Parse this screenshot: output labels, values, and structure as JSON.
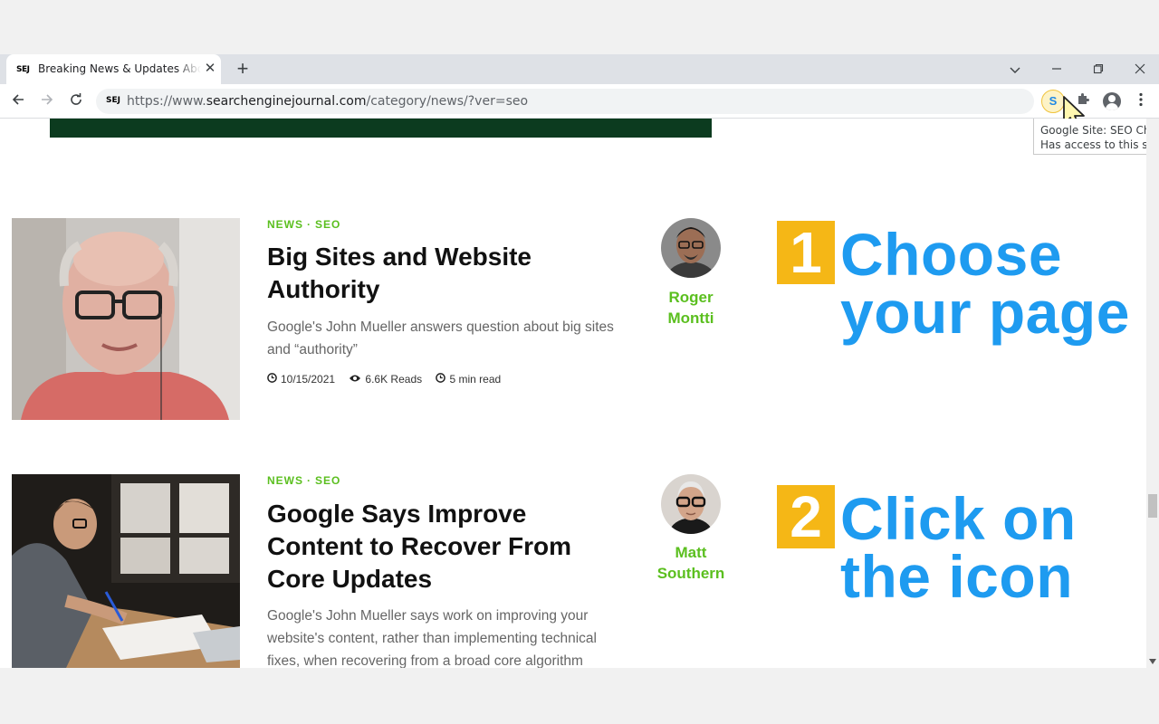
{
  "browser": {
    "tab_title": "Breaking News & Updates About SEO",
    "tab_favicon": "SEJ",
    "close_glyph": "✕",
    "new_tab_glyph": "+",
    "url_prefix": "https://www.",
    "url_host": "searchenginejournal.com",
    "url_path": "/category/news/?ver=seo",
    "omni_favicon": "SEJ",
    "extension_label": "S",
    "tooltip_line1": "Google Site: SEO Check",
    "tooltip_line2": "Has access to this site"
  },
  "articles": [
    {
      "cat1": "NEWS",
      "cat2": "SEO",
      "sep": "·",
      "headline": "Big Sites and Website Authority",
      "excerpt": "Google's John Mueller answers question about big sites and “authority”",
      "date": "10/15/2021",
      "reads": "6.6K Reads",
      "read_time": "5 min read",
      "author": "Roger Montti"
    },
    {
      "cat1": "NEWS",
      "cat2": "SEO",
      "sep": "·",
      "headline": "Google Says Improve Content to Recover From Core Updates",
      "excerpt": "Google's John Mueller says work on improving your website's content, rather than implementing technical fixes, when recovering from a broad core algorithm",
      "author": "Matt Southern"
    }
  ],
  "steps": [
    {
      "number": "1",
      "text": "Choose your page"
    },
    {
      "number": "2",
      "text": "Click on the icon"
    }
  ],
  "colors": {
    "accent_green": "#5bbf1f",
    "step_blue": "#1e9bf0",
    "step_badge": "#f5b716"
  }
}
